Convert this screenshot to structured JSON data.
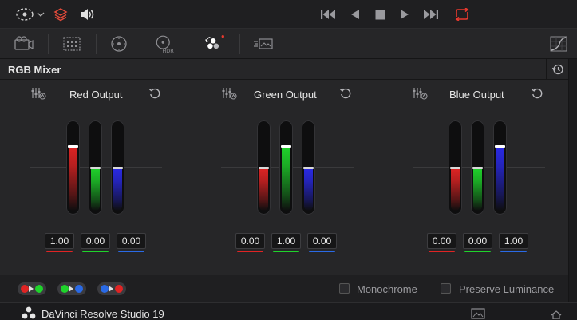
{
  "panel": {
    "title": "RGB Mixer"
  },
  "groups": [
    {
      "title": "Red Output",
      "values": [
        "1.00",
        "0.00",
        "0.00"
      ],
      "levels": [
        1.0,
        0.0,
        0.0
      ]
    },
    {
      "title": "Green Output",
      "values": [
        "0.00",
        "1.00",
        "0.00"
      ],
      "levels": [
        0.0,
        1.0,
        0.0
      ]
    },
    {
      "title": "Blue Output",
      "values": [
        "0.00",
        "0.00",
        "1.00"
      ],
      "levels": [
        0.0,
        0.0,
        1.0
      ]
    }
  ],
  "footer": {
    "monochrome_label": "Monochrome",
    "monochrome_checked": false,
    "preserve_luminance_label": "Preserve Luminance",
    "preserve_luminance_checked": false
  },
  "statusbar": {
    "app_name": "DaVinci Resolve Studio 19"
  },
  "colors": {
    "red": "#e02424",
    "green": "#1fd32b",
    "blue": "#2a2ae6",
    "loop_active": "#e8392e",
    "accent_layers": "#e24a3a"
  },
  "icons": {
    "topbar": [
      "viewer-mode-icon",
      "chevron-down-icon",
      "layers-icon",
      "speaker-icon",
      "skip-back-icon",
      "play-reverse-icon",
      "stop-icon",
      "play-icon",
      "skip-forward-icon",
      "loop-icon"
    ],
    "toolbar": [
      "camera-raw-icon",
      "color-match-icon",
      "primaries-wheels-icon",
      "hdr-wheels-icon",
      "rgb-mixer-icon",
      "motion-effects-icon",
      "curves-icon"
    ]
  }
}
